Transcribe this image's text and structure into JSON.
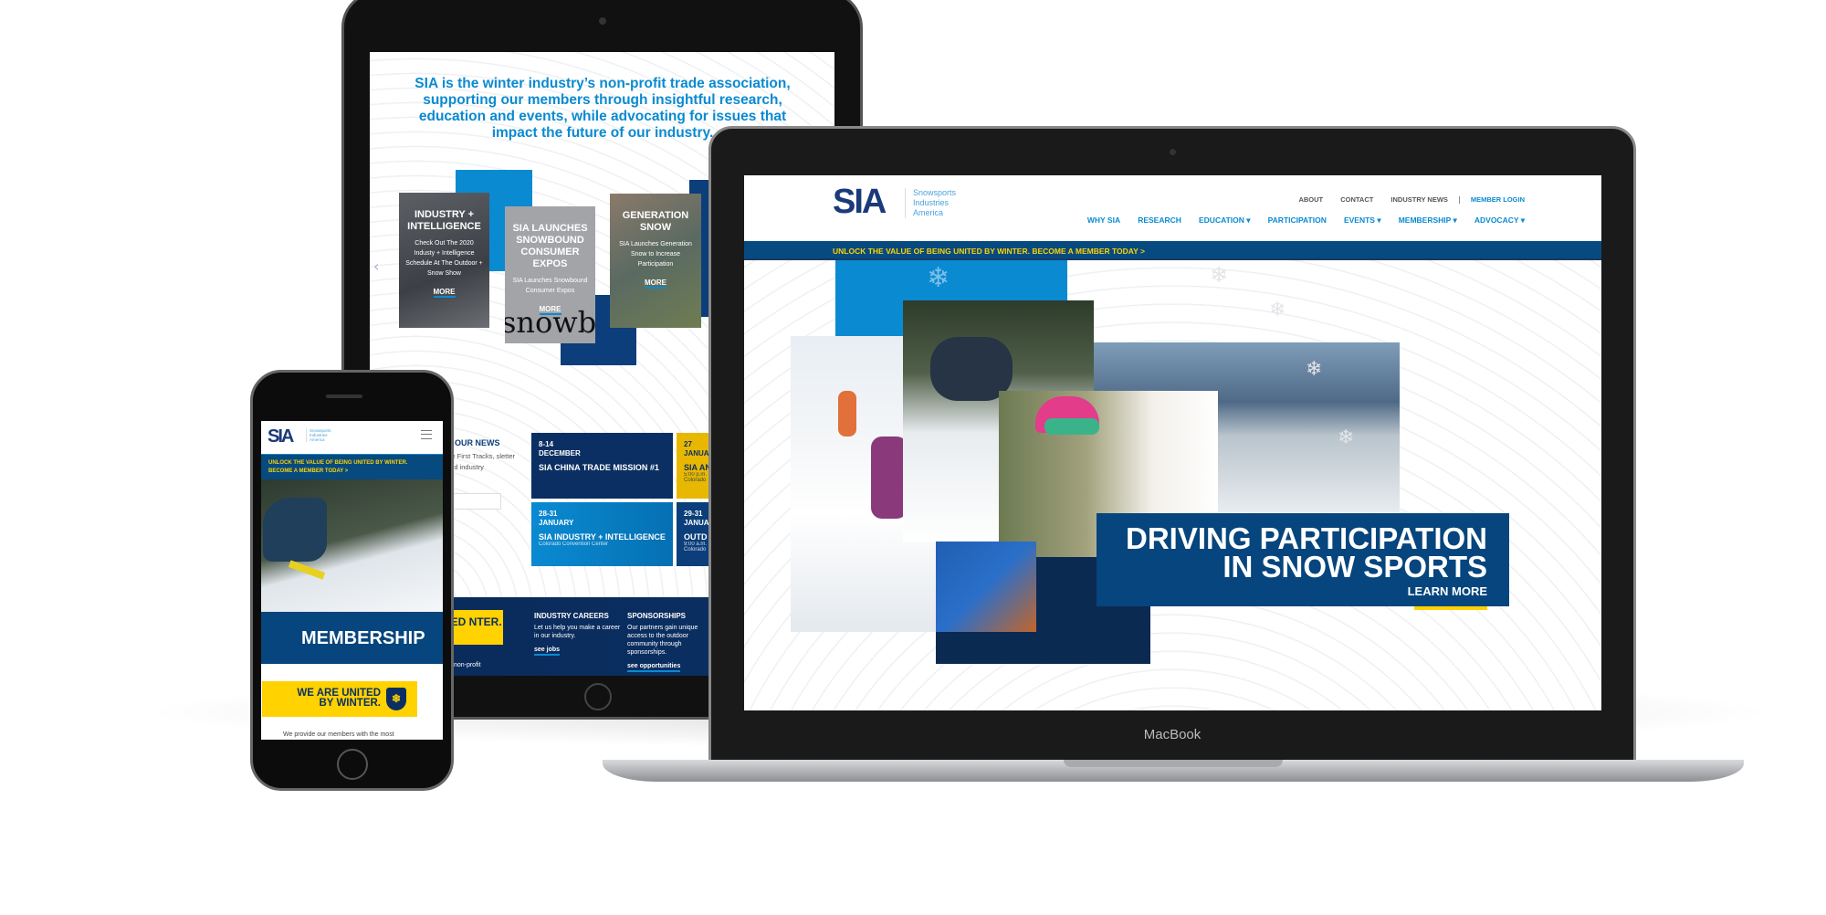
{
  "tablet": {
    "intro": "SIA is the winter industry’s non-profit trade association, supporting our members through insightful research, education and events, while advocating for issues that impact the future of our industry.",
    "cards": [
      {
        "title": "INDUSTRY + INTELLIGENCE",
        "body": "Check Out The 2020 Industy + Intelligence Schedule At The Outdoor + Snow Show",
        "more": "MORE"
      },
      {
        "title": "SIA LAUNCHES SNOWBOUND CONSUMER EXPOS",
        "body": "SIA Launches Snowbound Consumer Expos",
        "more": "MORE",
        "bg_word": "snowb"
      },
      {
        "title": "GENERATION SNOW",
        "body": "SIA Launches Generation Snow to Increase Participation",
        "more": "MORE"
      }
    ],
    "news": {
      "heading": "R OUR NEWS",
      "body": "ive First Tracks, sletter and industry",
      "input_placeholder": "s"
    },
    "events": [
      {
        "date": "8-14",
        "month": "DECEMBER",
        "title": "SIA CHINA TRADE MISSION #1",
        "location": ""
      },
      {
        "date": "27",
        "month": "JANUA",
        "title": "SIA AN",
        "location": "5:00 p.m. Colorado"
      },
      {
        "date": "28-31",
        "month": "JANUARY",
        "title": "SIA INDUSTRY + INTELLIGENCE",
        "location": "Colorado Convention Center"
      },
      {
        "date": "29-31",
        "month": "JANUA",
        "title": "OUTD",
        "location": "9:00 a.m. Colorado"
      }
    ],
    "footer": {
      "united": "ITED NTER.",
      "tagline": "ustry's non-profit",
      "careers": {
        "title": "INDUSTRY CAREERS",
        "body": "Let us help you make a career in our industry.",
        "link": "see jobs"
      },
      "sponsorships": {
        "title": "SPONSORSHIPS",
        "body": "Our partners gain unique access to the outdoor community through sponsorships.",
        "link": "see opportunities"
      }
    }
  },
  "laptop": {
    "brand": "MacBook",
    "logo": "SIA",
    "logo_tagline": [
      "Snowsports",
      "Industries",
      "America"
    ],
    "util_nav": [
      "ABOUT",
      "CONTACT",
      "INDUSTRY NEWS"
    ],
    "member_login": "MEMBER LOGIN",
    "main_nav": [
      "WHY SIA",
      "RESEARCH",
      "EDUCATION ▾",
      "PARTICIPATION",
      "EVENTS ▾",
      "MEMBERSHIP ▾",
      "ADVOCACY ▾"
    ],
    "banner": "UNLOCK THE VALUE OF BEING UNITED BY WINTER. BECOME A MEMBER TODAY >",
    "hero": {
      "title_line1": "DRIVING PARTICIPATION",
      "title_line2": "IN SNOW SPORTS",
      "cta": "LEARN MORE"
    }
  },
  "phone": {
    "logo": "SIA",
    "logo_tagline": [
      "Snowsports",
      "Industries",
      "America"
    ],
    "banner_line1": "UNLOCK THE VALUE OF BEING UNITED BY WINTER.",
    "banner_line2": "BECOME A MEMBER TODAY >",
    "section_title": "MEMBERSHIP",
    "united_line1": "WE ARE UNITED",
    "united_line2": "BY WINTER.",
    "body": "We provide our members with the most"
  },
  "colors": {
    "navy": "#06457d",
    "blue": "#0a8ad1",
    "yellow": "#ffd200",
    "dark_navy": "#0b2a52"
  }
}
